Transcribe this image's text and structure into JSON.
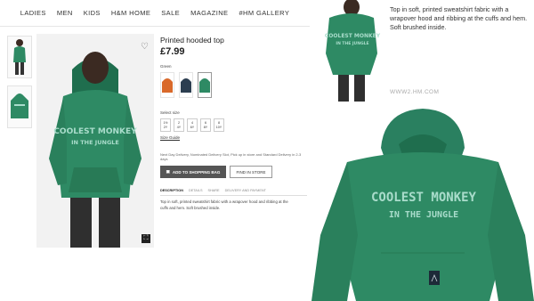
{
  "nav": {
    "items": [
      "LADIES",
      "MEN",
      "KIDS",
      "H&M HOME",
      "SALE",
      "MAGAZINE",
      "#HM GALLERY"
    ]
  },
  "product": {
    "title": "Printed hooded top",
    "price": "£7.99",
    "color_label": "Green",
    "select_size_label": "Select size",
    "sizes": [
      {
        "top": "1½",
        "bottom": "2Y"
      },
      {
        "top": "2",
        "bottom": "4Y"
      },
      {
        "top": "4",
        "bottom": "6Y"
      },
      {
        "top": "6",
        "bottom": "8Y"
      },
      {
        "top": "8",
        "bottom": "10Y"
      }
    ],
    "size_guide": "Size Guide",
    "delivery": "Next Day Delivery, Nominated Delivery Slot, Pick up in store and Standard Delivery in 2-3 days",
    "add_to_bag": "ADD TO SHOPPING BAG",
    "find_in_store": "FIND IN STORE",
    "tabs": [
      "DESCRIPTION",
      "DETAILS",
      "SHARE",
      "DELIVERY AND PAYMENT"
    ],
    "description": "Top in soft, printed sweatshirt fabric with a wrapover hood and ribbing at the cuffs and hem. Soft brushed inside.",
    "print_line1": "COOLEST MONKEY",
    "print_line2": "IN THE JUNGLE"
  },
  "zoom_panel": {
    "text": "Top in soft, printed sweatshirt fabric with a wrapover hood and ribbing at the cuffs and hem. Soft brushed inside.",
    "url": "WWW2.HM.COM"
  },
  "hoodie_print": {
    "line1": "COOLEST MONKEY",
    "line2": "IN THE JUNGLE"
  },
  "colors": {
    "hoodie_green": "#2e8a64",
    "hoodie_green_dark": "#1f6e4e",
    "print_text": "#a9dccb",
    "bag_button": "#555555",
    "swatches": [
      "#d9692a",
      "#2c3e50",
      "#2e8a64"
    ]
  }
}
